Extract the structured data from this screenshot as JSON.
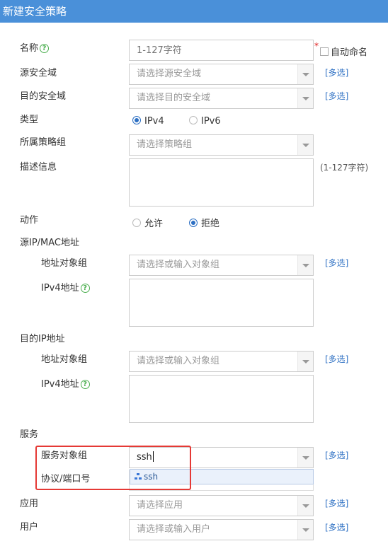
{
  "title": "新建安全策略",
  "labels": {
    "name": "名称",
    "src_zone": "源安全域",
    "dst_zone": "目的安全域",
    "type": "类型",
    "policy_group": "所属策略组",
    "description": "描述信息",
    "action": "动作",
    "src_ip_mac": "源IP/MAC地址",
    "src_addr_group": "地址对象组",
    "src_ipv4": "IPv4地址",
    "dst_ip": "目的IP地址",
    "dst_addr_group": "地址对象组",
    "dst_ipv4": "IPv4地址",
    "service": "服务",
    "service_group": "服务对象组",
    "protocol_port": "协议/端口号",
    "application": "应用",
    "user": "用户"
  },
  "placeholders": {
    "name": "1-127字符",
    "src_zone": "请选择源安全域",
    "dst_zone": "请选择目的安全域",
    "policy_group": "请选择策略组",
    "src_addr_group": "请选择或输入对象组",
    "dst_addr_group": "请选择或输入对象组",
    "application": "请选择应用",
    "user": "请选择或输入用户"
  },
  "values": {
    "service_group": "ssh"
  },
  "auto_name_label": "自动命名",
  "required_mark": "*",
  "multi_select": "[多选]",
  "desc_hint": "(1-127字符)",
  "type_options": [
    "IPv4",
    "IPv6"
  ],
  "type_selected": "IPv4",
  "action_options": [
    "允许",
    "拒绝"
  ],
  "action_selected": "拒绝",
  "dropdown_items": [
    "ssh"
  ],
  "colors": {
    "header_bg": "#4a90d9",
    "link": "#2c6fc3",
    "highlight_border": "#e53935"
  }
}
